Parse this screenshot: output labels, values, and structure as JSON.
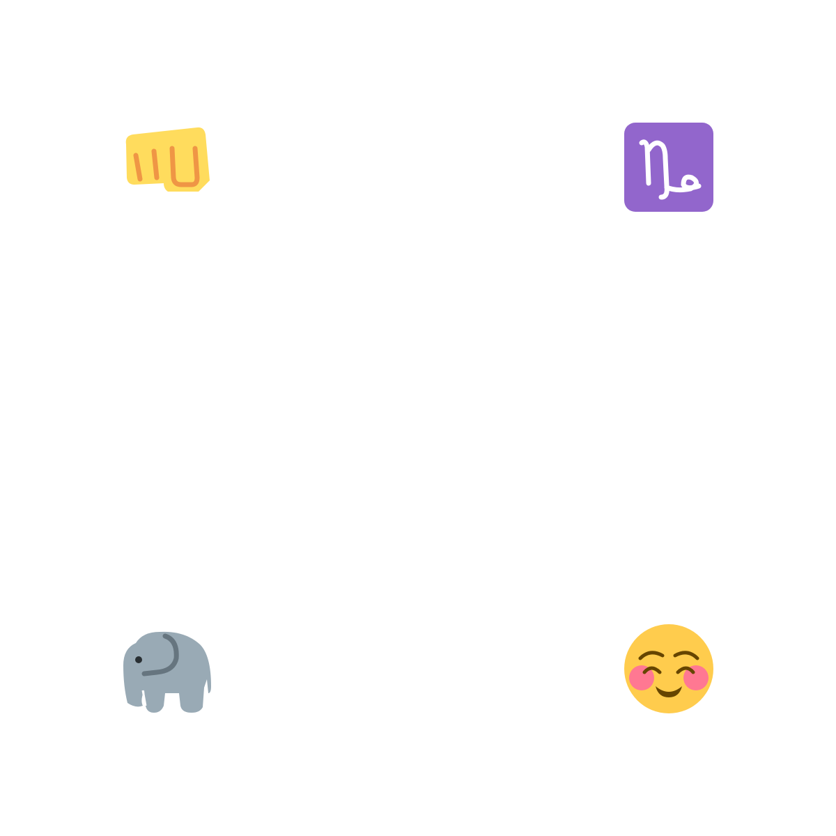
{
  "emojis": [
    {
      "name": "oncoming-fist",
      "skin_color": "#FFDC5D",
      "line_color": "#EF9645"
    },
    {
      "name": "capricorn",
      "background_color": "#9266CC",
      "glyph_color": "#FFFFFF"
    },
    {
      "name": "elephant",
      "body_color": "#99AAB5",
      "shade_color": "#66757F",
      "eye_color": "#292F33"
    },
    {
      "name": "smiling-face-with-smiling-eyes",
      "face_color": "#FFCC4D",
      "cheek_color": "#FF7892",
      "feature_color": "#664500"
    }
  ]
}
